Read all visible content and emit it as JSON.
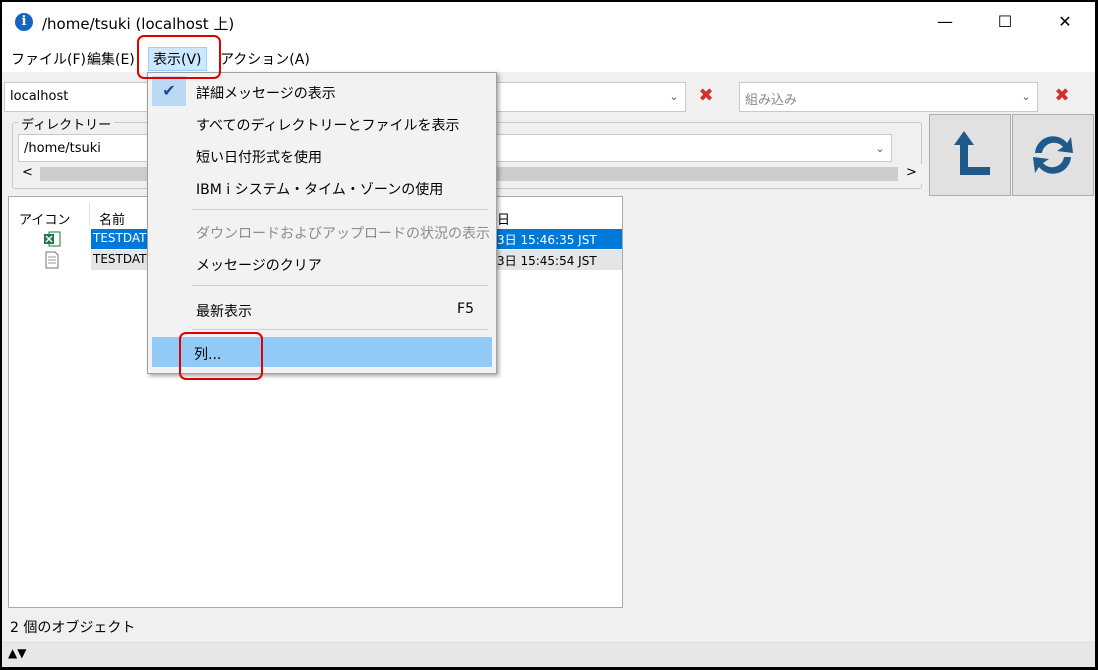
{
  "window": {
    "title": "/home/tsuki (localhost 上)",
    "minimize": "—",
    "maximize": "☐",
    "close": "✕"
  },
  "menubar": {
    "file": "ファイル(F)",
    "edit": "編集(E)",
    "view": "表示(V)",
    "action": "アクション(A)"
  },
  "toolbar": {
    "system": "localhost",
    "filter_placeholder": "組み込み"
  },
  "directory": {
    "label": "ディレクトリー",
    "path": "/home/tsuki"
  },
  "file_list": {
    "columns": [
      "アイコン",
      "名前",
      "日"
    ],
    "rows": [
      {
        "icon": "excel-file-icon",
        "name": "TESTDAT",
        "date": "3日 15:46:35 JST",
        "selected": true
      },
      {
        "icon": "text-file-icon",
        "name": "TESTDAT",
        "date": "3日 15:45:54 JST",
        "selected": false
      }
    ]
  },
  "view_menu": {
    "items": [
      {
        "label": "詳細メッセージの表示",
        "checked": true
      },
      {
        "label": "すべてのディレクトリーとファイルを表示"
      },
      {
        "label": "短い日付形式を使用"
      },
      {
        "label": "IBM i システム・タイム・ゾーンの使用"
      },
      {
        "label": "ダウンロードおよびアップロードの状況の表示",
        "disabled": true
      },
      {
        "label": "メッセージのクリア"
      },
      {
        "label": "最新表示",
        "shortcut": "F5"
      },
      {
        "label": "列..."
      }
    ]
  },
  "status": {
    "text": "2 個のオブジェクト",
    "toggle": "▲▼"
  },
  "colors": {
    "selection": "#0078d7",
    "highlight": "#91c9f7",
    "annotation": "#e00000",
    "toolbar_icon": "#1f5a8b"
  }
}
